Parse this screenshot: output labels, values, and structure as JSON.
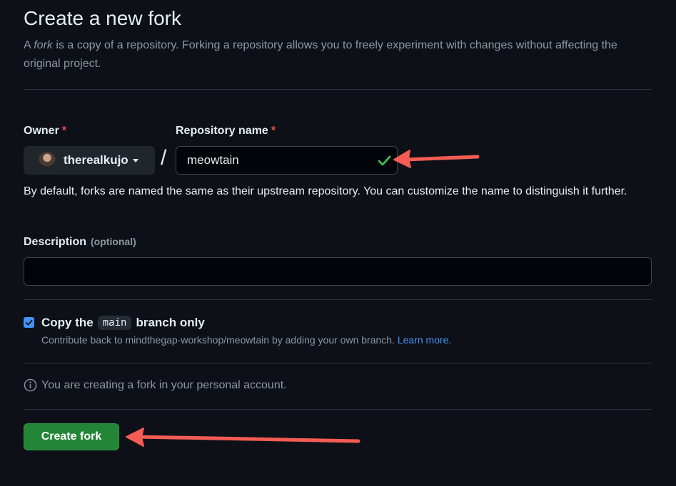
{
  "header": {
    "title": "Create a new fork",
    "subtitle_prefix": "A ",
    "subtitle_emphasis": "fork",
    "subtitle_rest": " is a copy of a repository. Forking a repository allows you to freely experiment with changes without affecting the original project."
  },
  "owner": {
    "label": "Owner",
    "required_mark": "*",
    "value": "therealkujo",
    "icon": "chevron-down-icon"
  },
  "separator": "/",
  "repository": {
    "label": "Repository name",
    "required_mark": "*",
    "value": "meowtain",
    "status_icon": "check-icon",
    "help": "By default, forks are named the same as their upstream repository. You can customize the name to distinguish it further."
  },
  "description": {
    "label": "Description",
    "optional_text": "(optional)",
    "value": ""
  },
  "copy_branch": {
    "checked": true,
    "label_prefix": "Copy the",
    "branch": "main",
    "label_suffix": "branch only",
    "help": "Contribute back to mindthegap-workshop/meowtain by adding your own branch.",
    "link_text": "Learn more."
  },
  "info": {
    "icon": "info-icon",
    "text": "You are creating a fork in your personal account."
  },
  "actions": {
    "create_label": "Create fork"
  },
  "colors": {
    "background": "#0d1117",
    "primary_button": "#238636",
    "checkbox": "#4493f8",
    "required": "#f85149",
    "success_check": "#3fb950",
    "annotation_arrow": "#f45c55"
  }
}
